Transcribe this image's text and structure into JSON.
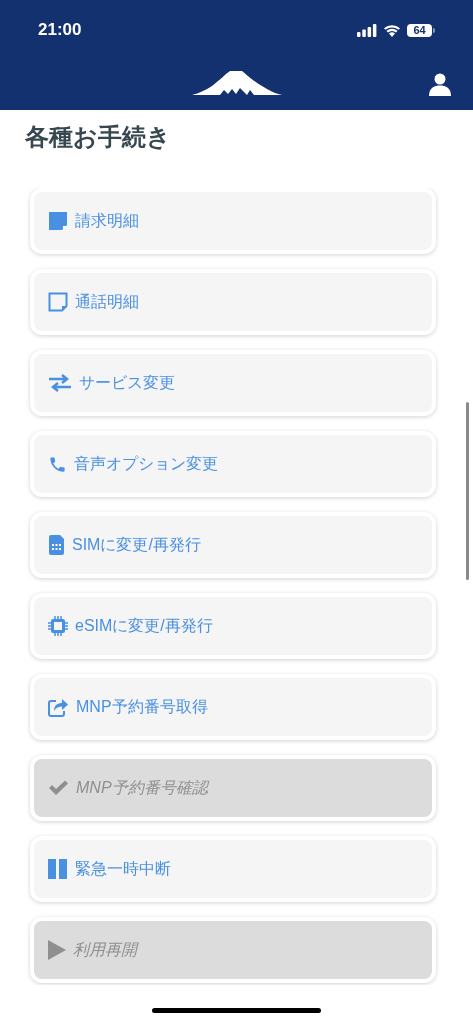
{
  "status_bar": {
    "time": "21:00",
    "battery": "64"
  },
  "page": {
    "title": "各種お手続き"
  },
  "menu_items": [
    {
      "kind": "note_filled",
      "label": "請求明細",
      "disabled": false
    },
    {
      "kind": "note_outline",
      "label": "通話明細",
      "disabled": false
    },
    {
      "kind": "swap",
      "label": "サービス変更",
      "disabled": false
    },
    {
      "kind": "phone",
      "label": "音声オプション変更",
      "disabled": false
    },
    {
      "kind": "sim",
      "label": "SIMに変更/再発行",
      "disabled": false
    },
    {
      "kind": "chip",
      "label": "eSIMに変更/再発行",
      "disabled": false
    },
    {
      "kind": "share",
      "label": "MNP予約番号取得",
      "disabled": false
    },
    {
      "kind": "check",
      "label": "MNP予約番号確認",
      "disabled": true
    },
    {
      "kind": "pause",
      "label": "緊急一時中断",
      "disabled": false
    },
    {
      "kind": "play",
      "label": "利用再開",
      "disabled": true
    }
  ]
}
